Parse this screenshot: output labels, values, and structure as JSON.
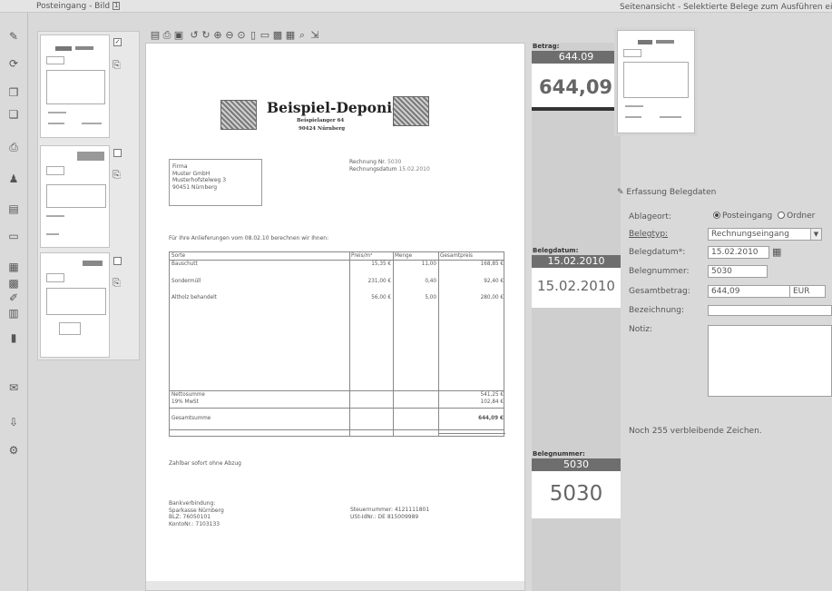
{
  "inbox": {
    "title": "Posteingang - Bild",
    "title_box": "1"
  },
  "right_panel": {
    "title": "Seitenansicht - Selektierte Belege zum Ausführen ei"
  },
  "toolbar_icons": [
    "new-icon",
    "print-icon",
    "save-icon",
    "rotate-left-icon",
    "rotate-right-icon",
    "zoom-in-icon",
    "zoom-out-icon",
    "zoom-fit-icon",
    "page-icon",
    "view-icon",
    "image-icon",
    "search-icon",
    "export-icon"
  ],
  "document": {
    "company": "Beispiel-Deponie",
    "street": "Beispielanger 64",
    "city": "90424 Nürnberg",
    "recipient": [
      "Firma",
      "Muster GmbH",
      "Musterhofstelweg 3",
      "90451 Nürnberg"
    ],
    "invoice_no_label": "Rechnung Nr.",
    "invoice_no": "5030",
    "invoice_date_label": "Rechnungsdatum",
    "invoice_date": "15.02.2010",
    "intro": "Für Ihre Anlieferungen vom 08.02.10 berechnen wir Ihnen:",
    "table_headers": [
      "Sorte",
      "Preis/m³",
      "Menge",
      "Gesamtpreis"
    ],
    "rows": [
      [
        "Bauschutt",
        "15,35 €",
        "11,00",
        "168,85 €"
      ],
      [
        "Sondermüll",
        "231,00 €",
        "0,40",
        "92,40 €"
      ],
      [
        "Altholz behandelt",
        "56,00 €",
        "5,00",
        "280,00 €"
      ]
    ],
    "net_label": "Nettosumme",
    "net_value": "541,25 €",
    "vat_label": "19% MwSt",
    "vat_value": "102,84 €",
    "total_label": "Gesamtsumme",
    "total_value": "644,09 €",
    "payment": "Zahlbar sofort ohne Abzug",
    "bank": [
      "Bankverbindung:",
      "Sparkasse Nürnberg",
      "BLZ: 76050101",
      "KontoNr.: 7103133"
    ],
    "tax": [
      "Steuernummer: 4121111801",
      "USt-IdNr.: DE 815009989"
    ]
  },
  "extract": {
    "amount_label": "Betrag:",
    "amount_bar": "644.09",
    "amount_big": "644,09 €",
    "date_label": "Belegdatum:",
    "date_bar": "15.02.2010",
    "date_big": "15.02.2010",
    "number_label": "Belegnummer:",
    "number_bar": "5030",
    "number_big": "5030"
  },
  "form": {
    "section_title": "Erfassung Belegdaten",
    "ablageort_label": "Ablageort:",
    "option_posteingang": "Posteingang",
    "option_ordner": "Ordner",
    "belegtyp_label": "Belegtyp:",
    "belegtyp_value": "Rechnungseingang",
    "belegdatum_label": "Belegdatum*:",
    "belegdatum_value": "15.02.2010",
    "belegnummer_label": "Belegnummer:",
    "belegnummer_value": "5030",
    "gesamtbetrag_label": "Gesamtbetrag:",
    "gesamtbetrag_value": "644,09",
    "currency_value": "EUR",
    "bezeichnung_label": "Bezeichnung:",
    "bezeichnung_value": "",
    "notiz_label": "Notiz:",
    "notiz_value": "",
    "remaining": "Noch 255 verbleibende Zeichen."
  }
}
